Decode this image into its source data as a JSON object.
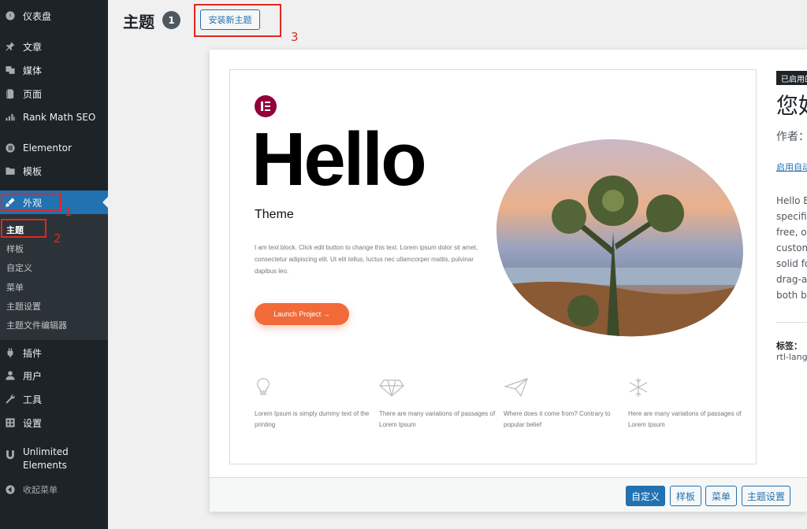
{
  "sidebar": {
    "items": [
      {
        "label": "仪表盘",
        "icon": "dashboard-icon"
      },
      {
        "label": "文章",
        "icon": "pin-icon"
      },
      {
        "label": "媒体",
        "icon": "media-icon"
      },
      {
        "label": "页面",
        "icon": "page-icon"
      },
      {
        "label": "Rank Math SEO",
        "icon": "chart-icon"
      },
      {
        "label": "Elementor",
        "icon": "elementor-icon"
      },
      {
        "label": "模板",
        "icon": "folder-icon"
      },
      {
        "label": "外观",
        "icon": "brush-icon"
      },
      {
        "label": "插件",
        "icon": "plugin-icon"
      },
      {
        "label": "用户",
        "icon": "user-icon"
      },
      {
        "label": "工具",
        "icon": "wrench-icon"
      },
      {
        "label": "设置",
        "icon": "settings-icon"
      },
      {
        "label": "Unlimited Elements",
        "icon": "unlimited-icon"
      }
    ],
    "submenu": [
      "主题",
      "样板",
      "自定义",
      "菜单",
      "主题设置",
      "主题文件编辑器"
    ],
    "collapse_label": "收起菜单"
  },
  "header": {
    "title": "主题",
    "count": "1",
    "add_new_label": "安装新主题"
  },
  "annotations": [
    "1",
    "2",
    "3"
  ],
  "theme_details": {
    "active_badge": "已启用的",
    "name": "您好",
    "author": "作者：",
    "auto_update": "启用自动更新",
    "description": [
      "Hello E",
      "specific",
      "free, op",
      "custom",
      "solid fo",
      "drag-a",
      "both b"
    ],
    "tags_label": "标签：",
    "tags_value": "rtl-language"
  },
  "preview": {
    "hello": "Hello",
    "theme_word": "Theme",
    "lorem": "I am text block. Click edit button to change this text. Lorem ipsum dolor sit amet, consectetur adipiscing elit. Ut elit tellus, luctus nec ullamcorper mattis, pulvinar dapibus leo.",
    "launch_label": "Launch Project  →",
    "features": [
      {
        "icon": "lightbulb-icon",
        "text": "Lorem Ipsum is simply dummy text of the printing"
      },
      {
        "icon": "diamond-icon",
        "text": "There are many variations of passages of Lorem Ipsum"
      },
      {
        "icon": "paper-plane-icon",
        "text": "Where does it come from? Contrary to popular belief"
      },
      {
        "icon": "snowflake-icon",
        "text": "Here are many variations of passages of Lorem Ipsum"
      }
    ]
  },
  "footer_buttons": [
    "自定义",
    "样板",
    "菜单",
    "主题设置"
  ],
  "colors": {
    "sidebar": "#1d2327",
    "accent": "#2271b1",
    "annotation": "#e0281f",
    "launch": "#f26a3a"
  }
}
